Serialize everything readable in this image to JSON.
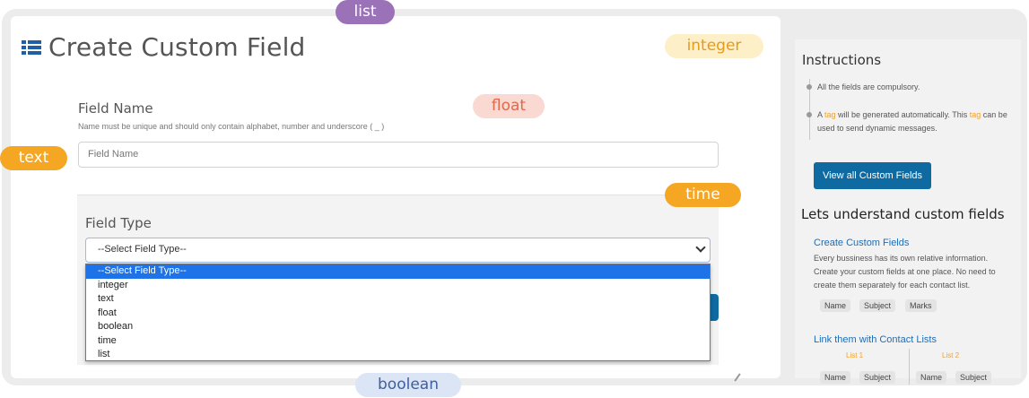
{
  "page": {
    "title": "Create Custom Field"
  },
  "form": {
    "field_name_label": "Field Name",
    "field_name_hint": "Name must be unique and should only contain alphabet, number and underscore ( _ )",
    "field_name_placeholder": "Field Name",
    "field_type_label": "Field Type",
    "field_type_selected": "--Select Field Type--",
    "field_type_options": [
      "--Select Field Type--",
      "integer",
      "text",
      "float",
      "boolean",
      "time",
      "list"
    ]
  },
  "floating_labels": {
    "list": "list",
    "integer": "integer",
    "float": "float",
    "text": "text",
    "time": "time",
    "boolean": "boolean"
  },
  "sidebar": {
    "instructions_title": "Instructions",
    "instruction_1": "All the fields are compulsory.",
    "instruction_2_pre": "A ",
    "instruction_2_tag": "tag",
    "instruction_2_mid": " will be generated automatically. This ",
    "instruction_2_tag2": "tag",
    "instruction_2_post": " can be used to send dynamic messages.",
    "view_all_button": "View all Custom Fields",
    "understand_title": "Lets understand custom fields",
    "create_title": "Create Custom Fields",
    "create_desc": "Every bussiness has its own relative information. Create your custom fields at one place. No need to create them separately for each contact list.",
    "chips": [
      "Name",
      "Subject",
      "Marks"
    ],
    "link_title": "Link them with Contact Lists",
    "list1_label": "List 1",
    "list2_label": "List 2",
    "list_chips": [
      "Name",
      "Subject",
      "Name",
      "Subject"
    ]
  },
  "colors": {
    "accent": "#0e6aa0",
    "icon_blue": "#1f5fa8",
    "tag_orange": "#f0a030",
    "dropdown_highlight": "#1e73e8"
  },
  "icons": {
    "title_icon": "list-icon",
    "select_chevron": "chevron-down-icon"
  }
}
